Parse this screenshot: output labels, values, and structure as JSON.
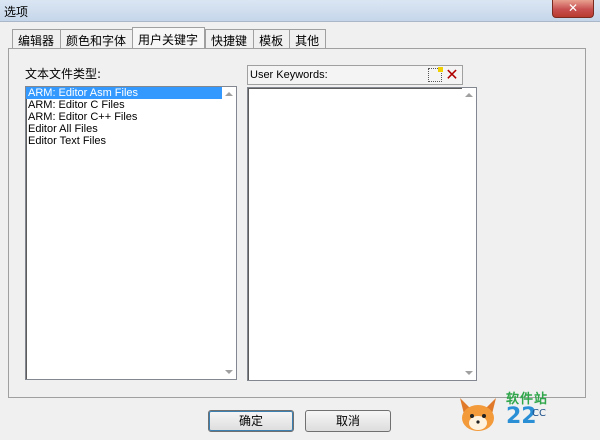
{
  "window": {
    "title": "选项",
    "close_glyph": "✕"
  },
  "tabs": [
    {
      "label": "编辑器",
      "active": false
    },
    {
      "label": "颜色和字体",
      "active": false
    },
    {
      "label": "用户关键字",
      "active": true
    },
    {
      "label": "快捷键",
      "active": false
    },
    {
      "label": "模板",
      "active": false
    },
    {
      "label": "其他",
      "active": false
    }
  ],
  "filetypes": {
    "label": "文本文件类型:",
    "items": [
      {
        "label": "ARM: Editor Asm Files",
        "selected": true
      },
      {
        "label": "ARM: Editor C Files",
        "selected": false
      },
      {
        "label": "ARM: Editor C++ Files",
        "selected": false
      },
      {
        "label": "Editor All Files",
        "selected": false
      },
      {
        "label": "Editor Text Files",
        "selected": false
      }
    ]
  },
  "keywords": {
    "title": "User Keywords:",
    "new_icon": "new-item-icon",
    "delete_glyph": "✕",
    "items": []
  },
  "buttons": {
    "ok": "确定",
    "cancel": "取消"
  },
  "watermark": {
    "line1": "软件站",
    "line2": "22",
    "line3": "CC"
  },
  "colors": {
    "selection": "#3399ff",
    "delete": "#b00000"
  }
}
